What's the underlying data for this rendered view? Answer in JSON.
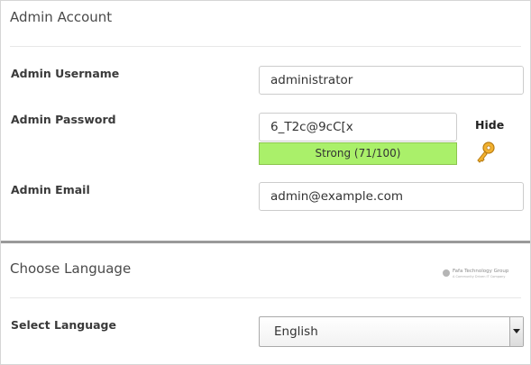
{
  "admin_account": {
    "title": "Admin Account",
    "username": {
      "label": "Admin Username",
      "value": "administrator"
    },
    "password": {
      "label": "Admin Password",
      "value": "6_T2c@9cC[x",
      "strength_text": "Strong (71/100)",
      "strength_color": "#aaf06a",
      "toggle_label": "Hide",
      "icon": "key-icon"
    },
    "email": {
      "label": "Admin Email",
      "value": "admin@example.com"
    }
  },
  "language": {
    "title": "Choose Language",
    "brand_logo": {
      "name": "Fafa Technology Group",
      "tagline": "A Community Driven IT Company"
    },
    "select": {
      "label": "Select Language",
      "value": "English"
    }
  }
}
